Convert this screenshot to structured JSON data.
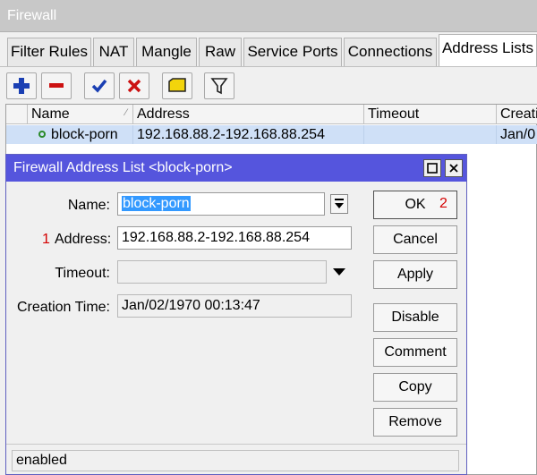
{
  "window": {
    "title": "Firewall"
  },
  "tabs": [
    {
      "label": "Filter Rules"
    },
    {
      "label": "NAT"
    },
    {
      "label": "Mangle"
    },
    {
      "label": "Raw"
    },
    {
      "label": "Service Ports"
    },
    {
      "label": "Connections"
    },
    {
      "label": "Address Lists"
    }
  ],
  "active_tab": "Address Lists",
  "toolbar": {
    "icons": [
      "add-icon",
      "remove-icon",
      "enable-check-icon",
      "disable-x-icon",
      "comment-note-icon",
      "filter-icon"
    ],
    "colors": {
      "add": "#1a3fb3",
      "remove": "#cc1111",
      "check": "#1a3fb3",
      "x": "#cc1111",
      "note": "#f2d40c"
    }
  },
  "table": {
    "columns": [
      "Name",
      "Address",
      "Timeout",
      "Creati"
    ],
    "rows": [
      {
        "name": "block-porn",
        "address": "192.168.88.2-192.168.88.254",
        "timeout": "",
        "creation": "Jan/0"
      }
    ]
  },
  "dialog": {
    "title": "Firewall Address List <block-porn>",
    "fields": {
      "name_label": "Name:",
      "name_value": "block-porn",
      "address_label": "Address:",
      "address_value": "192.168.88.2-192.168.88.254",
      "timeout_label": "Timeout:",
      "timeout_value": "",
      "creation_label": "Creation Time:",
      "creation_value": "Jan/02/1970 00:13:47"
    },
    "buttons": {
      "ok": "OK",
      "cancel": "Cancel",
      "apply": "Apply",
      "disable": "Disable",
      "comment": "Comment",
      "copy": "Copy",
      "remove": "Remove"
    },
    "annotations": {
      "address_marker": "1",
      "ok_marker": "2"
    },
    "status": "enabled"
  },
  "colors": {
    "dialog_title_bg": "#5555dd",
    "selected_row": "#cfe0f7",
    "marker": "#d40000"
  }
}
